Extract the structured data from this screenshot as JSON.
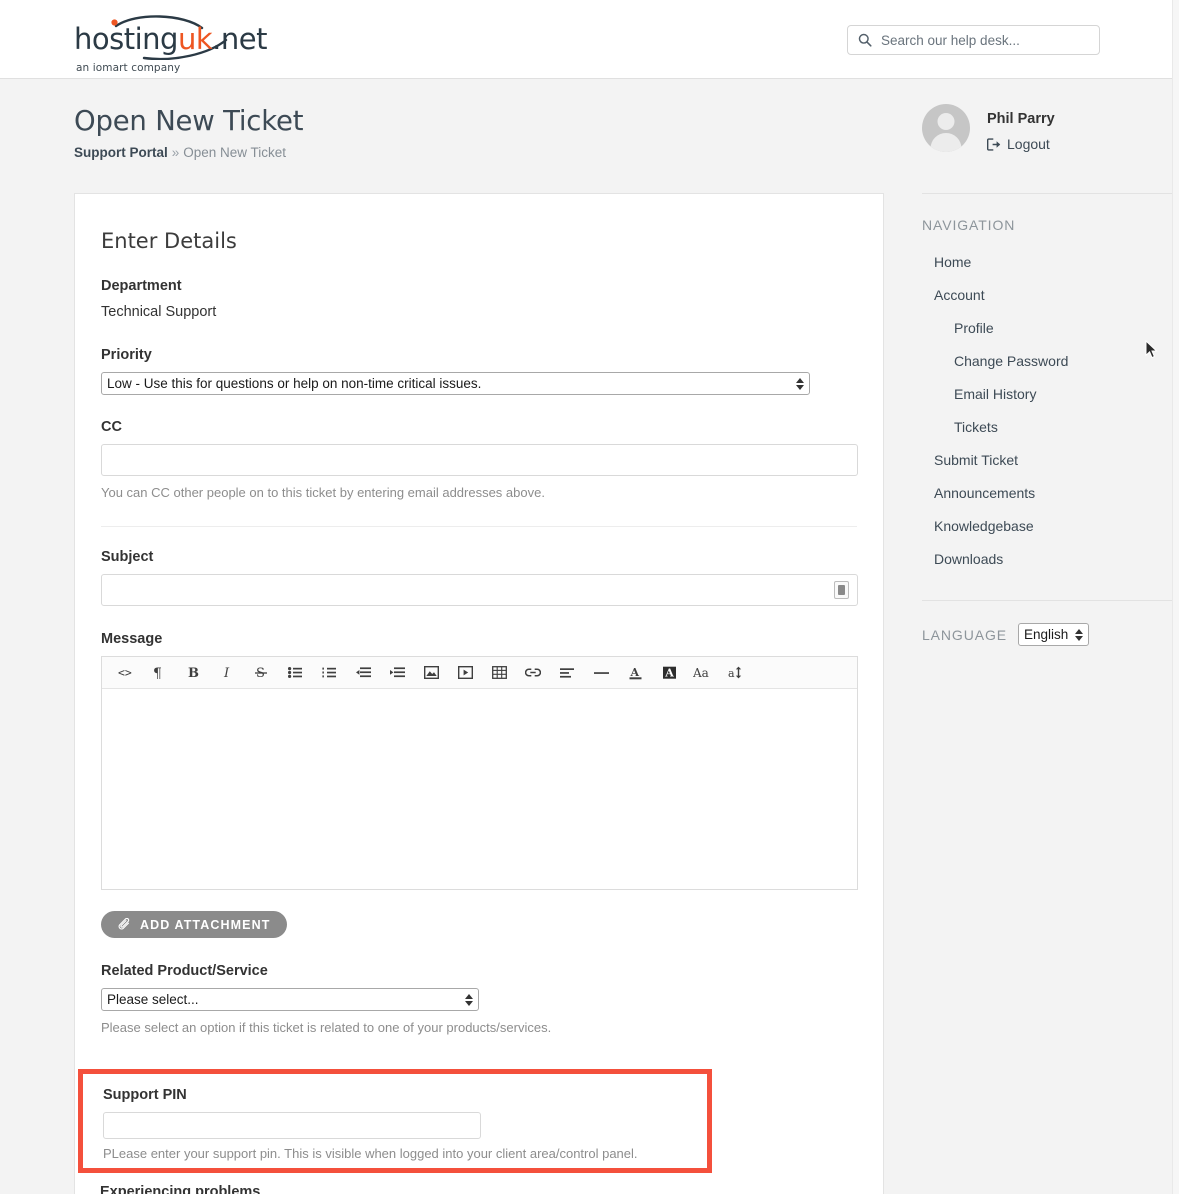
{
  "header": {
    "logo": {
      "part1": "hosting",
      "part2": "uk",
      "part3": ".net",
      "tagline": "an iomart company",
      "color_dark": "#2b3a45",
      "color_accent": "#ee5622"
    },
    "search": {
      "placeholder": "Search our help desk...",
      "value": "",
      "icon": "search-icon"
    }
  },
  "page": {
    "title": "Open New Ticket",
    "breadcrumb": {
      "root": "Support Portal",
      "separator": "»",
      "current": "Open New Ticket"
    }
  },
  "form": {
    "section_title": "Enter Details",
    "department": {
      "label": "Department",
      "value": "Technical Support"
    },
    "priority": {
      "label": "Priority",
      "selected": "Low - Use this for questions or help on non-time critical issues."
    },
    "cc": {
      "label": "CC",
      "value": "",
      "help": "You can CC other people on to this ticket by entering email addresses above."
    },
    "subject": {
      "label": "Subject",
      "value": "",
      "key_icon": "password-manager-icon"
    },
    "message": {
      "label": "Message",
      "value": "",
      "toolbar": [
        {
          "name": "code-view-icon",
          "title": "Code View"
        },
        {
          "name": "paragraph-icon",
          "title": "Paragraph"
        },
        {
          "name": "bold-icon",
          "title": "Bold"
        },
        {
          "name": "italic-icon",
          "title": "Italic"
        },
        {
          "name": "strikethrough-icon",
          "title": "Strikethrough"
        },
        {
          "name": "unordered-list-icon",
          "title": "Unordered List"
        },
        {
          "name": "ordered-list-icon",
          "title": "Ordered List"
        },
        {
          "name": "outdent-icon",
          "title": "Outdent"
        },
        {
          "name": "indent-icon",
          "title": "Indent"
        },
        {
          "name": "image-icon",
          "title": "Insert Image"
        },
        {
          "name": "video-icon",
          "title": "Insert Video"
        },
        {
          "name": "table-icon",
          "title": "Insert Table"
        },
        {
          "name": "link-icon",
          "title": "Insert Link"
        },
        {
          "name": "align-icon",
          "title": "Align"
        },
        {
          "name": "horizontal-rule-icon",
          "title": "Horizontal Rule"
        },
        {
          "name": "text-color-icon",
          "title": "Text Color"
        },
        {
          "name": "background-color-icon",
          "title": "Background Color"
        },
        {
          "name": "font-size-icon",
          "title": "Font Size"
        },
        {
          "name": "line-height-icon",
          "title": "Line Height"
        }
      ]
    },
    "attachment": {
      "label": "ADD ATTACHMENT",
      "icon": "paperclip-icon"
    },
    "related_product": {
      "label": "Related Product/Service",
      "selected": "Please select...",
      "help": "Please select an option if this ticket is related to one of your products/services."
    },
    "support_pin": {
      "label": "Support PIN",
      "value": "",
      "help": "PLease enter your support pin. This is visible when logged into your client area/control panel.",
      "highlight_color": "#f4503c"
    },
    "cut_off_label": "Experiencing problems"
  },
  "sidebar": {
    "user": {
      "name": "Phil Parry",
      "logout_label": "Logout",
      "logout_icon": "logout-icon",
      "avatar_icon": "avatar-placeholder-icon"
    },
    "nav_heading": "NAVIGATION",
    "nav_items": [
      {
        "label": "Home",
        "sub": false
      },
      {
        "label": "Account",
        "sub": false
      },
      {
        "label": "Profile",
        "sub": true
      },
      {
        "label": "Change Password",
        "sub": true
      },
      {
        "label": "Email History",
        "sub": true
      },
      {
        "label": "Tickets",
        "sub": true
      },
      {
        "label": "Submit Ticket",
        "sub": false
      },
      {
        "label": "Announcements",
        "sub": false
      },
      {
        "label": "Knowledgebase",
        "sub": false
      },
      {
        "label": "Downloads",
        "sub": false
      }
    ],
    "language": {
      "label": "LANGUAGE",
      "selected": "English"
    }
  }
}
